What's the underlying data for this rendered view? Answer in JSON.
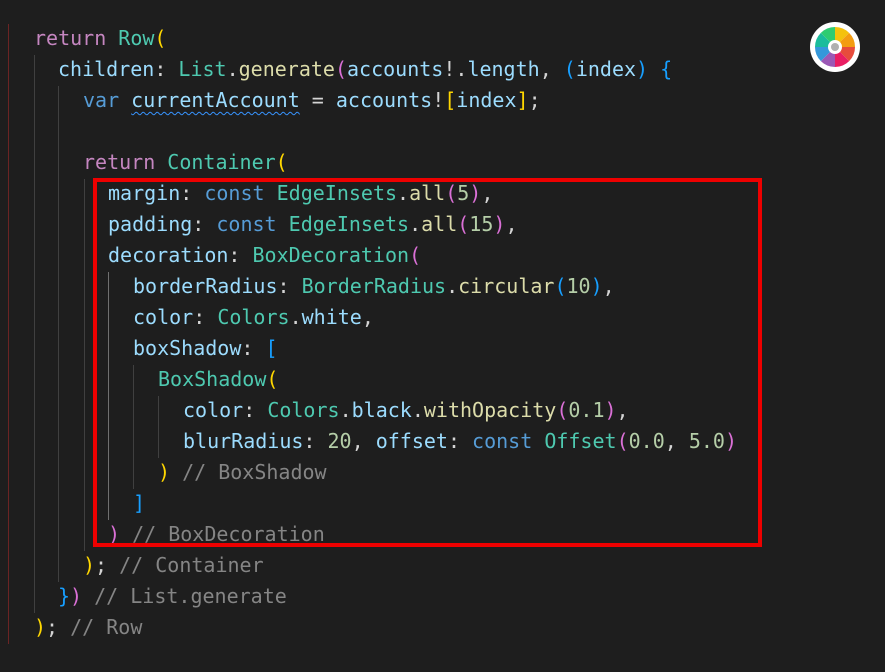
{
  "code": {
    "line1": {
      "kw": "return",
      "type": "Row",
      "open": "("
    },
    "line2": {
      "prop": "children",
      "colon": ": ",
      "type": "List",
      "dot": ".",
      "func": "generate",
      "open": "(",
      "var": "accounts",
      "bang": "!.",
      "prop2": "length",
      "comma": ", ",
      "paren_open": "(",
      "param": "index",
      "paren_close": ")",
      "space": " ",
      "brace": "{"
    },
    "line3": {
      "kw": "var",
      "space1": " ",
      "var": "currentAccount",
      "eq": " = ",
      "var2": "accounts",
      "bang": "!",
      "bopen": "[",
      "idx": "index",
      "bclose": "]",
      "semi": ";"
    },
    "line5": {
      "kw": "return",
      "type": "Container",
      "open": "("
    },
    "line6": {
      "prop": "margin",
      "colon": ": ",
      "kw": "const",
      "type": "EdgeInsets",
      "dot": ".",
      "func": "all",
      "open": "(",
      "num": "5",
      "close": ")",
      "comma": ","
    },
    "line7": {
      "prop": "padding",
      "colon": ": ",
      "kw": "const",
      "type": "EdgeInsets",
      "dot": ".",
      "func": "all",
      "open": "(",
      "num": "15",
      "close": ")",
      "comma": ","
    },
    "line8": {
      "prop": "decoration",
      "colon": ": ",
      "type": "BoxDecoration",
      "open": "("
    },
    "line9": {
      "prop": "borderRadius",
      "colon": ": ",
      "type": "BorderRadius",
      "dot": ".",
      "func": "circular",
      "open": "(",
      "num": "10",
      "close": ")",
      "comma": ","
    },
    "line10": {
      "prop": "color",
      "colon": ": ",
      "type": "Colors",
      "dot": ".",
      "prop2": "white",
      "comma": ","
    },
    "line11": {
      "prop": "boxShadow",
      "colon": ": ",
      "open": "["
    },
    "line12": {
      "type": "BoxShadow",
      "open": "("
    },
    "line13": {
      "prop": "color",
      "colon": ": ",
      "type": "Colors",
      "dot": ".",
      "prop2": "black",
      "dot2": ".",
      "func": "withOpacity",
      "open": "(",
      "num": "0.1",
      "close": ")",
      "comma": ","
    },
    "line14": {
      "prop": "blurRadius",
      "colon": ": ",
      "num": "20",
      "comma": ", ",
      "prop2": "offset",
      "colon2": ": ",
      "kw": "const",
      "type": "Offset",
      "open": "(",
      "num1": "0.0",
      "comma2": ", ",
      "num2": "5.0",
      "close": ")"
    },
    "line15": {
      "close": ")",
      "comment": "// BoxShadow"
    },
    "line16": {
      "close": "]"
    },
    "line17": {
      "close": ")",
      "comment": "// BoxDecoration"
    },
    "line18": {
      "close": ")",
      "semi": ";",
      "comment": "// Container"
    },
    "line19": {
      "brace": "}",
      "close": ")",
      "comment": "// List.generate"
    },
    "line20": {
      "close": ")",
      "semi": ";",
      "comment": "// Row"
    }
  },
  "colors": {
    "background": "#1e1e1e",
    "highlight_border": "#ee0000"
  },
  "icons": {
    "top_right": "color-wheel-icon"
  }
}
